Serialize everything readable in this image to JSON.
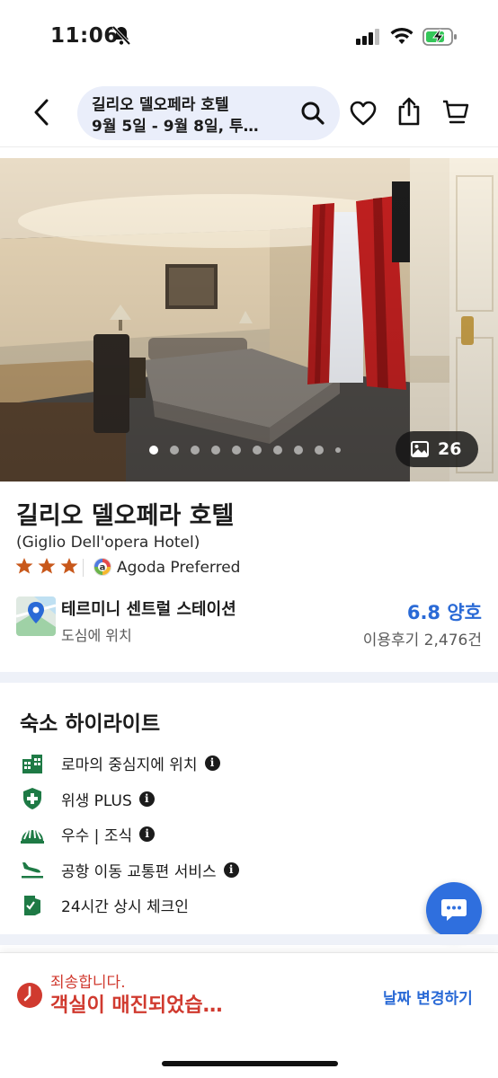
{
  "status_bar": {
    "time": "11:06"
  },
  "header": {
    "search_line1": "길리오 델오페라 호텔",
    "search_line2": "9월 5일 - 9월 8일, 투…"
  },
  "gallery": {
    "photo_count": "26",
    "total_dots": 10,
    "active_dot_index": 0
  },
  "hotel": {
    "name": "길리오 델오페라 호텔",
    "name_en": "(Giglio Dell'opera Hotel)",
    "stars": 3,
    "badge_label": "Agoda Preferred",
    "location_name": "테르미니 센트럴 스테이션",
    "location_sub": "도심에 위치",
    "rating": "6.8 양호",
    "reviews": "이용후기 2,476건"
  },
  "highlights": {
    "title": "숙소 하이라이트",
    "items": [
      {
        "label": "로마의 중심지에 위치",
        "icon": "city-building-icon",
        "info": true
      },
      {
        "label": "위생 PLUS",
        "icon": "health-shield-icon",
        "info": true
      },
      {
        "label": "우수 | 조식",
        "icon": "breakfast-icon",
        "info": true
      },
      {
        "label": "공항 이동 교통편 서비스",
        "icon": "airplane-landing-icon",
        "info": true
      },
      {
        "label": "24시간 상시 체크인",
        "icon": "door-checkin-icon",
        "info": false
      }
    ]
  },
  "bottom_bar": {
    "sorry": "죄송합니다.",
    "message": "객실이 매진되었습…",
    "change_date": "날짜 변경하기"
  },
  "colors": {
    "accent_blue": "#2a6ad6",
    "alert_red": "#d03a2f",
    "star_orange": "#c8581b",
    "icon_green": "#1e7a45",
    "search_pill": "#eaeefa"
  }
}
